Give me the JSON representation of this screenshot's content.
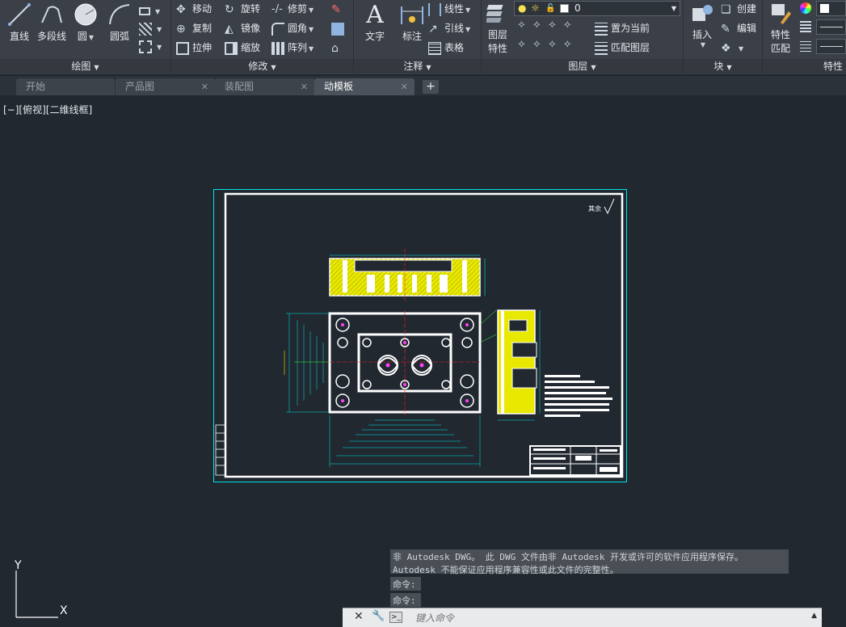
{
  "ribbon": {
    "draw": {
      "title": "绘图",
      "tools": [
        {
          "label": "直线",
          "icon": "line-icon"
        },
        {
          "label": "多段线",
          "icon": "polyline-icon"
        },
        {
          "label": "圆",
          "icon": "circle-icon"
        },
        {
          "label": "圆弧",
          "icon": "arc-icon"
        }
      ]
    },
    "modify": {
      "title": "修改",
      "tools": [
        "移动",
        "旋转",
        "修剪",
        "复制",
        "镜像",
        "圆角",
        "拉伸",
        "缩放",
        "阵列"
      ]
    },
    "annotation": {
      "title": "注释",
      "text_label": "文字",
      "dim_label": "标注",
      "tools": [
        "线性",
        "引线",
        "表格"
      ]
    },
    "layers": {
      "title": "图层",
      "props_label": "图层\n特性",
      "props_line1": "图层",
      "props_line2": "特性",
      "current_layer": "0",
      "tools": [
        "置为当前",
        "匹配图层"
      ]
    },
    "block": {
      "title": "块",
      "insert_label": "插入",
      "tools": [
        "创建",
        "编辑"
      ]
    },
    "properties": {
      "title": "特性",
      "match_line1": "特性",
      "match_line2": "匹配"
    }
  },
  "tabs": [
    {
      "label": "开始",
      "active": false,
      "closable": false
    },
    {
      "label": "产品图",
      "active": false,
      "closable": true
    },
    {
      "label": "装配图",
      "active": false,
      "closable": true
    },
    {
      "label": "动模板",
      "active": true,
      "closable": true
    }
  ],
  "tab_add_symbol": "+",
  "tab_close_symbol": "✕",
  "viewport_label": "[−][俯视][二维线框]",
  "drawing": {
    "corner_mark": "其余"
  },
  "command_history": [
    "非 Autodesk DWG。 此 DWG 文件由非 Autodesk 开发或许可的软件应用程序保存。",
    "Autodesk 不能保证应用程序兼容性或此文件的完整性。",
    "命令:",
    "命令:"
  ],
  "command_input_placeholder": "键入命令",
  "ucs": {
    "x_label": "X",
    "y_label": "Y"
  },
  "colors": {
    "background": "#212830",
    "ribbon": "#3b4048",
    "frame_white": "#ffffff",
    "cyan": "#00e5e5",
    "hatch_yellow": "#e8e800",
    "magenta": "#ff40ff",
    "red": "#ff2020",
    "green": "#40ff40"
  }
}
